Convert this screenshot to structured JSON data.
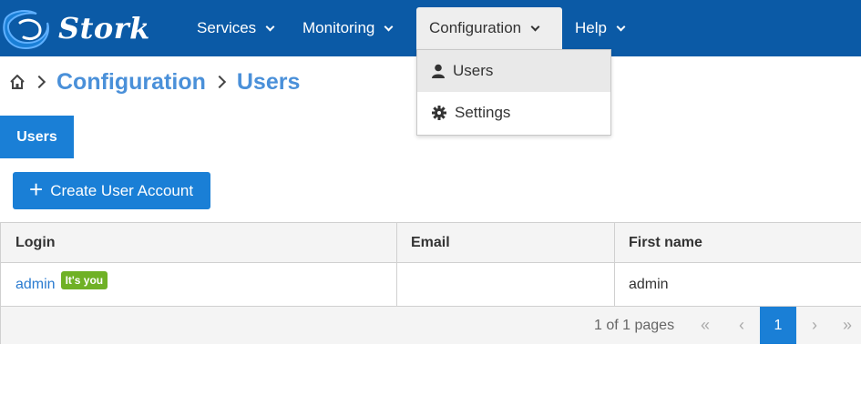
{
  "app": {
    "name": "Stork",
    "brand_color": "#0b5aa6",
    "accent_color": "#1a7fd6"
  },
  "nav": {
    "items": [
      {
        "label": "Services",
        "icon": "chevron-down-icon"
      },
      {
        "label": "Monitoring",
        "icon": "chevron-down-icon"
      },
      {
        "label": "Configuration",
        "icon": "chevron-down-icon",
        "active": true
      },
      {
        "label": "Help",
        "icon": "chevron-down-icon"
      }
    ]
  },
  "dropdown": {
    "items": [
      {
        "label": "Users",
        "icon": "user-icon",
        "selected": true
      },
      {
        "label": "Settings",
        "icon": "gear-icon"
      }
    ]
  },
  "breadcrumb": {
    "home_icon": "home-icon",
    "items": [
      "Configuration",
      "Users"
    ]
  },
  "tabs": {
    "items": [
      {
        "label": "Users"
      }
    ]
  },
  "toolbar": {
    "create_label": "Create User Account",
    "create_icon": "plus-icon"
  },
  "table": {
    "columns": [
      "Login",
      "Email",
      "First name"
    ],
    "rows": [
      {
        "login": "admin",
        "badge": "It's you",
        "badge_color": "#6fb125",
        "email": "",
        "first_name": "admin"
      }
    ]
  },
  "paginator": {
    "report": "1 of 1 pages",
    "current_page": "1",
    "first_icon": "double-chevron-left-icon",
    "prev_icon": "chevron-left-icon",
    "next_icon": "chevron-right-icon",
    "last_icon": "double-chevron-right-icon"
  }
}
